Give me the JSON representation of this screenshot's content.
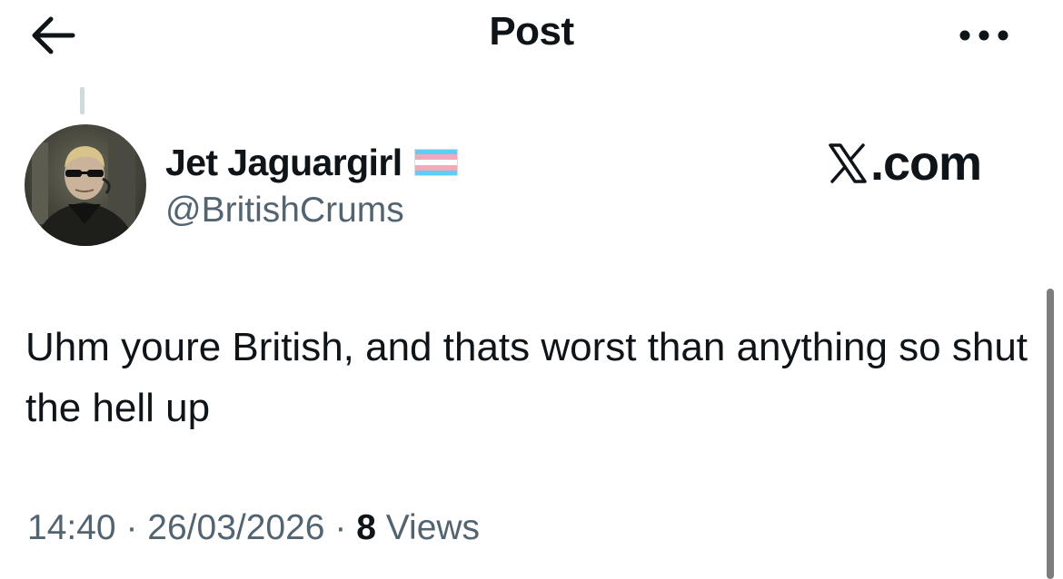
{
  "header": {
    "title": "Post",
    "back_icon": "arrow-left-icon",
    "more_icon": "more-horizontal-icon"
  },
  "author": {
    "name": "Jet Jaguargirl",
    "handle": "@BritishCrums",
    "badge_icon": "transgender-flag-icon",
    "avatar_icon": "user-avatar"
  },
  "brand": {
    "logo_icon": "x-logo-icon",
    "text": ".com"
  },
  "post": {
    "text": "Uhm youre British, and thats worst than anything so shut the hell up",
    "time": "14:40",
    "date": "26/03/2026",
    "separator": "·",
    "views_count": "8",
    "views_label": "Views"
  },
  "colors": {
    "text": "#0f1419",
    "secondary": "#536471",
    "flag_blue": "#5BCEFA",
    "flag_pink": "#F5A9B8"
  }
}
